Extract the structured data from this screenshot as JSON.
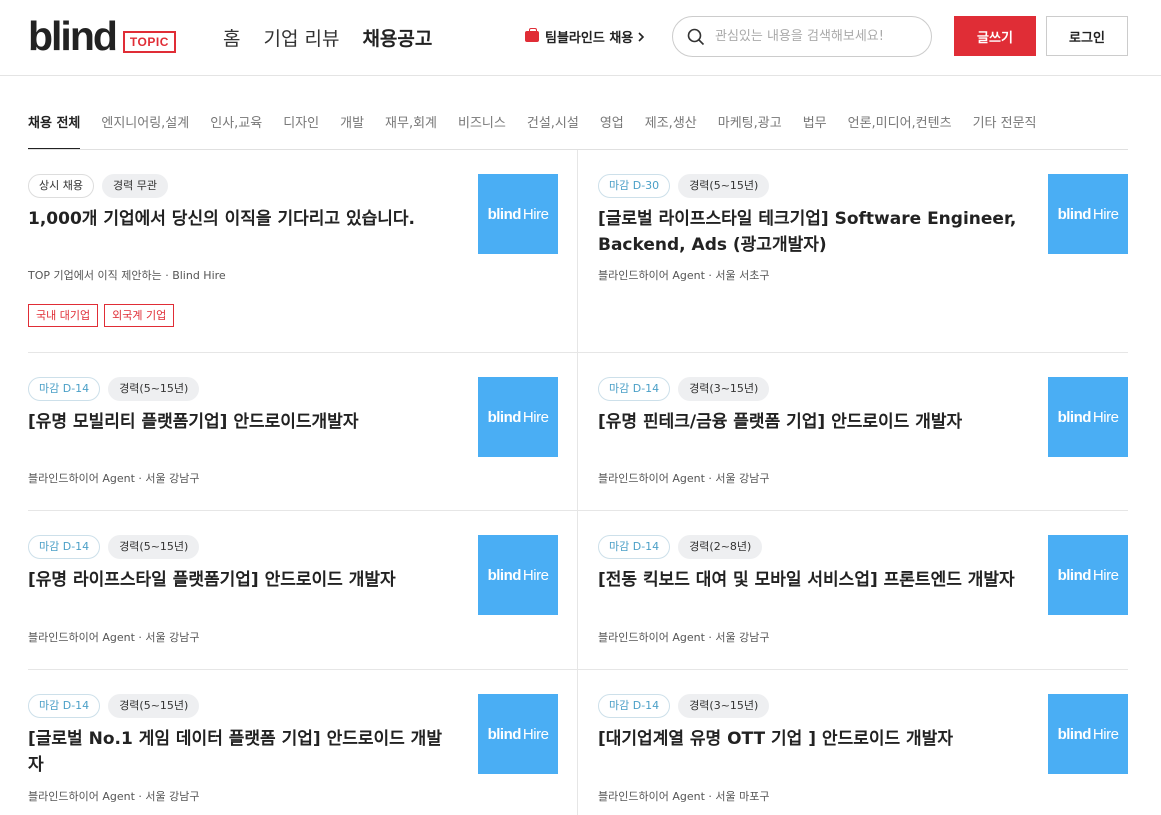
{
  "header": {
    "logo": "blind",
    "logo_badge": "TOPIC",
    "nav": [
      "홈",
      "기업 리뷰",
      "채용공고"
    ],
    "team_link": "팀블라인드 채용",
    "search_placeholder": "관심있는 내용을 검색해보세요!",
    "write_label": "글쓰기",
    "login_label": "로그인"
  },
  "categories": [
    "채용 전체",
    "엔지니어링,설계",
    "인사,교육",
    "디자인",
    "개발",
    "재무,회계",
    "비즈니스",
    "건설,시설",
    "영업",
    "제조,생산",
    "마케팅,광고",
    "법무",
    "언론,미디어,컨텐츠",
    "기타 전문직"
  ],
  "thumb": {
    "bold": "blind",
    "light": "Hire"
  },
  "colors": {
    "accent": "#e02d36",
    "thumb": "#4aaef4"
  },
  "jobs": [
    {
      "tag1": "상시 채용",
      "tag2": "경력 무관",
      "title": "1,000개 기업에서 당신의 이직을 기다리고 있습니다.",
      "meta": "TOP 기업에서 이직 제안하는 · Blind Hire",
      "kw1": "국내 대기업",
      "kw2": "외국계 기업"
    },
    {
      "tag1": "마감 D-30",
      "tag2": "경력(5~15년)",
      "title": "[글로벌 라이프스타일 테크기업] Software Engineer, Backend, Ads (광고개발자)",
      "meta": "블라인드하이어 Agent · 서울 서초구"
    },
    {
      "tag1": "마감 D-14",
      "tag2": "경력(5~15년)",
      "title": "[유명 모빌리티 플랫폼기업] 안드로이드개발자",
      "meta": "블라인드하이어 Agent · 서울 강남구"
    },
    {
      "tag1": "마감 D-14",
      "tag2": "경력(3~15년)",
      "title": "[유명 핀테크/금융 플랫폼 기업] 안드로이드 개발자",
      "meta": "블라인드하이어 Agent · 서울 강남구"
    },
    {
      "tag1": "마감 D-14",
      "tag2": "경력(5~15년)",
      "title": "[유명 라이프스타일 플랫폼기업] 안드로이드 개발자",
      "meta": "블라인드하이어 Agent · 서울 강남구"
    },
    {
      "tag1": "마감 D-14",
      "tag2": "경력(2~8년)",
      "title": "[전동 킥보드 대여 및 모바일 서비스업] 프론트엔드 개발자",
      "meta": "블라인드하이어 Agent · 서울 강남구"
    },
    {
      "tag1": "마감 D-14",
      "tag2": "경력(5~15년)",
      "title": "[글로벌 No.1 게임 데이터 플랫폼 기업] 안드로이드 개발자",
      "meta": "블라인드하이어 Agent · 서울 강남구"
    },
    {
      "tag1": "마감 D-14",
      "tag2": "경력(3~15년)",
      "title": "[대기업계열 유명 OTT 기업 ] 안드로이드 개발자",
      "meta": "블라인드하이어 Agent · 서울 마포구"
    }
  ]
}
